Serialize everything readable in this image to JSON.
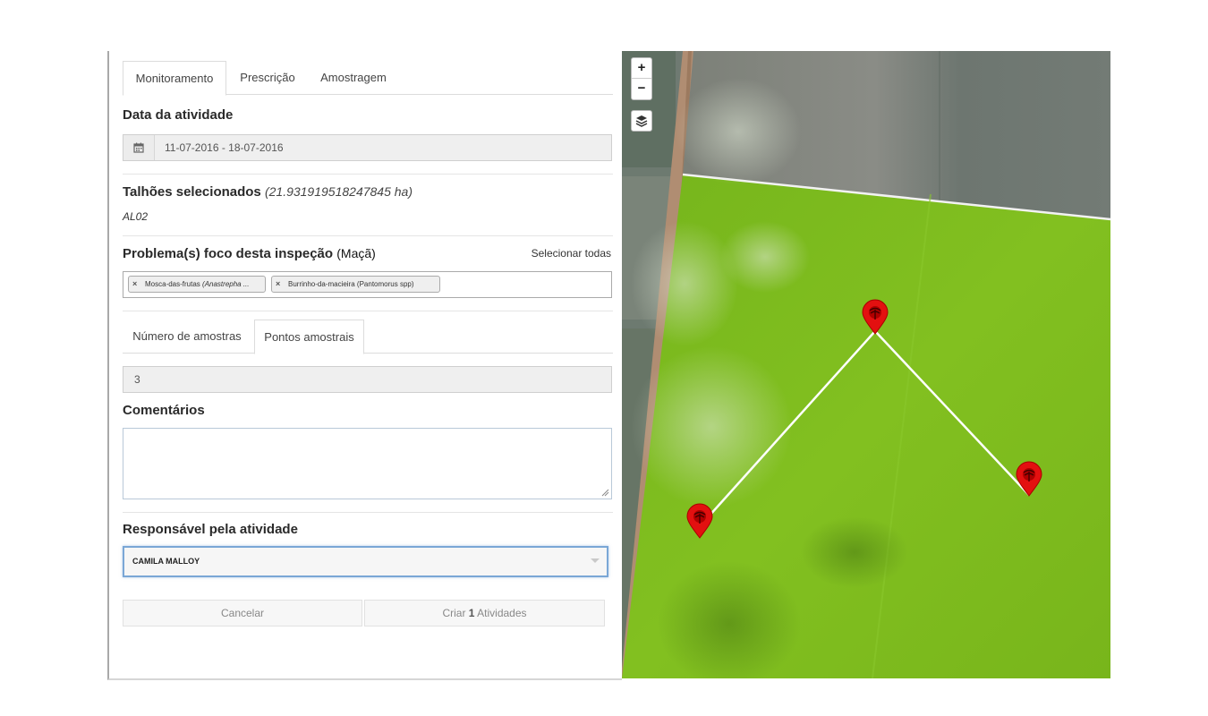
{
  "tabs": [
    {
      "label": "Monitoramento",
      "active": true
    },
    {
      "label": "Prescrição",
      "active": false
    },
    {
      "label": "Amostragem",
      "active": false
    }
  ],
  "activity_date": {
    "title": "Data da atividade",
    "icon": "calendar-icon",
    "value": "11-07-2016 - 18-07-2016"
  },
  "plots": {
    "title": "Talhões selecionados",
    "area": "(21.931919518247845 ha)",
    "items": "AL02"
  },
  "problems": {
    "title": "Problema(s) foco desta inspeção",
    "crop": "(Maçã)",
    "select_all": "Selecionar todas",
    "tags": [
      {
        "name": "Mosca-das-frutas",
        "scientific": "(Anastrepha ..."
      },
      {
        "name": "Burrinho-da-macieira (Pantomorus spp)",
        "scientific": ""
      }
    ]
  },
  "sample_tabs": [
    {
      "label": "Número de amostras",
      "active": false
    },
    {
      "label": "Pontos amostrais",
      "active": true
    }
  ],
  "sample_count": "3",
  "comments": {
    "title": "Comentários",
    "value": ""
  },
  "responsible": {
    "title": "Responsável pela atividade",
    "value": "CAMILA MALLOY"
  },
  "buttons": {
    "cancel": "Cancelar",
    "create_prefix": "Criar",
    "create_count": "1",
    "create_suffix": "Atividades"
  },
  "map": {
    "zoom_in": "+",
    "zoom_out": "−",
    "layers_icon": "layers-icon",
    "marker_icon": "sample-point-marker-icon",
    "field_color": "#7dba1e",
    "marker_color": "#e31010"
  }
}
